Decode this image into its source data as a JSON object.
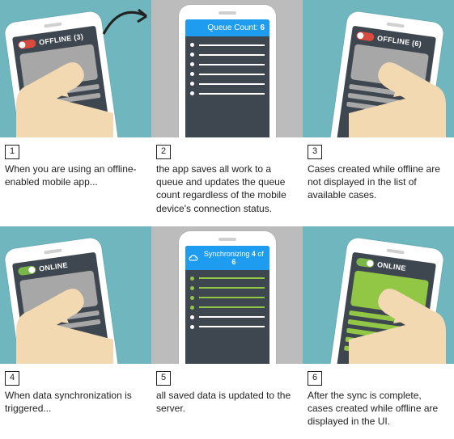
{
  "panels": [
    {
      "num": "1",
      "caption": "When you are using an offline-enabled mobile app...",
      "status_label": "OFFLINE (3)"
    },
    {
      "num": "2",
      "caption": "the app saves all work to a queue and updates the queue count regardless of the mobile device's connection status.",
      "queue_prefix": "Queue Count: ",
      "queue_count": "6"
    },
    {
      "num": "3",
      "caption": "Cases created while offline are not displayed in the list of available cases.",
      "status_label": "OFFLINE (6)"
    },
    {
      "num": "4",
      "caption": "When data synchronization is triggered...",
      "status_label": "ONLINE"
    },
    {
      "num": "5",
      "caption": "all saved data is updated to the server.",
      "sync_prefix": "Synchronizing ",
      "sync_done": "4",
      "sync_mid": " of ",
      "sync_total": "6"
    },
    {
      "num": "6",
      "caption": "After the sync is complete, cases created while offline are displayed in the UI.",
      "status_label": "ONLINE"
    }
  ]
}
